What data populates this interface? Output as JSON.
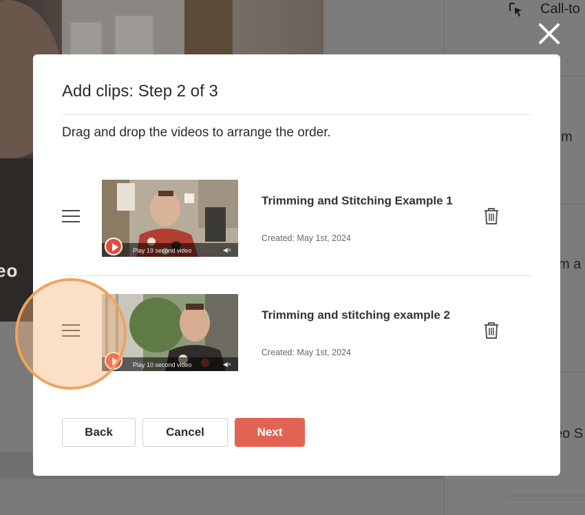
{
  "background": {
    "video_overlay_text": "eo",
    "right_panel": {
      "cta_label": "Call-to",
      "partial_texts": [
        "um",
        "m a",
        "eo S"
      ]
    }
  },
  "modal": {
    "title": "Add clips: Step 2 of 3",
    "instructions": "Drag and drop the videos to arrange the order.",
    "clips": [
      {
        "title": "Trimming and Stitching Example 1",
        "created": "Created: May 1st, 2024",
        "play_label": "Play 19 second video",
        "mute_icon": "◀×"
      },
      {
        "title": "Trimming and stitching example 2",
        "created": "Created: May 1st, 2024",
        "play_label": "Play 10 second video",
        "mute_icon": "◀×"
      }
    ],
    "buttons": {
      "back": "Back",
      "cancel": "Cancel",
      "next": "Next"
    }
  },
  "colors": {
    "primary": "#e36352",
    "highlight": "#f0a35e"
  },
  "icons": [
    "drag-handle-icon",
    "trash-icon",
    "close-icon",
    "play-icon",
    "cursor-click-icon",
    "mute-icon"
  ]
}
